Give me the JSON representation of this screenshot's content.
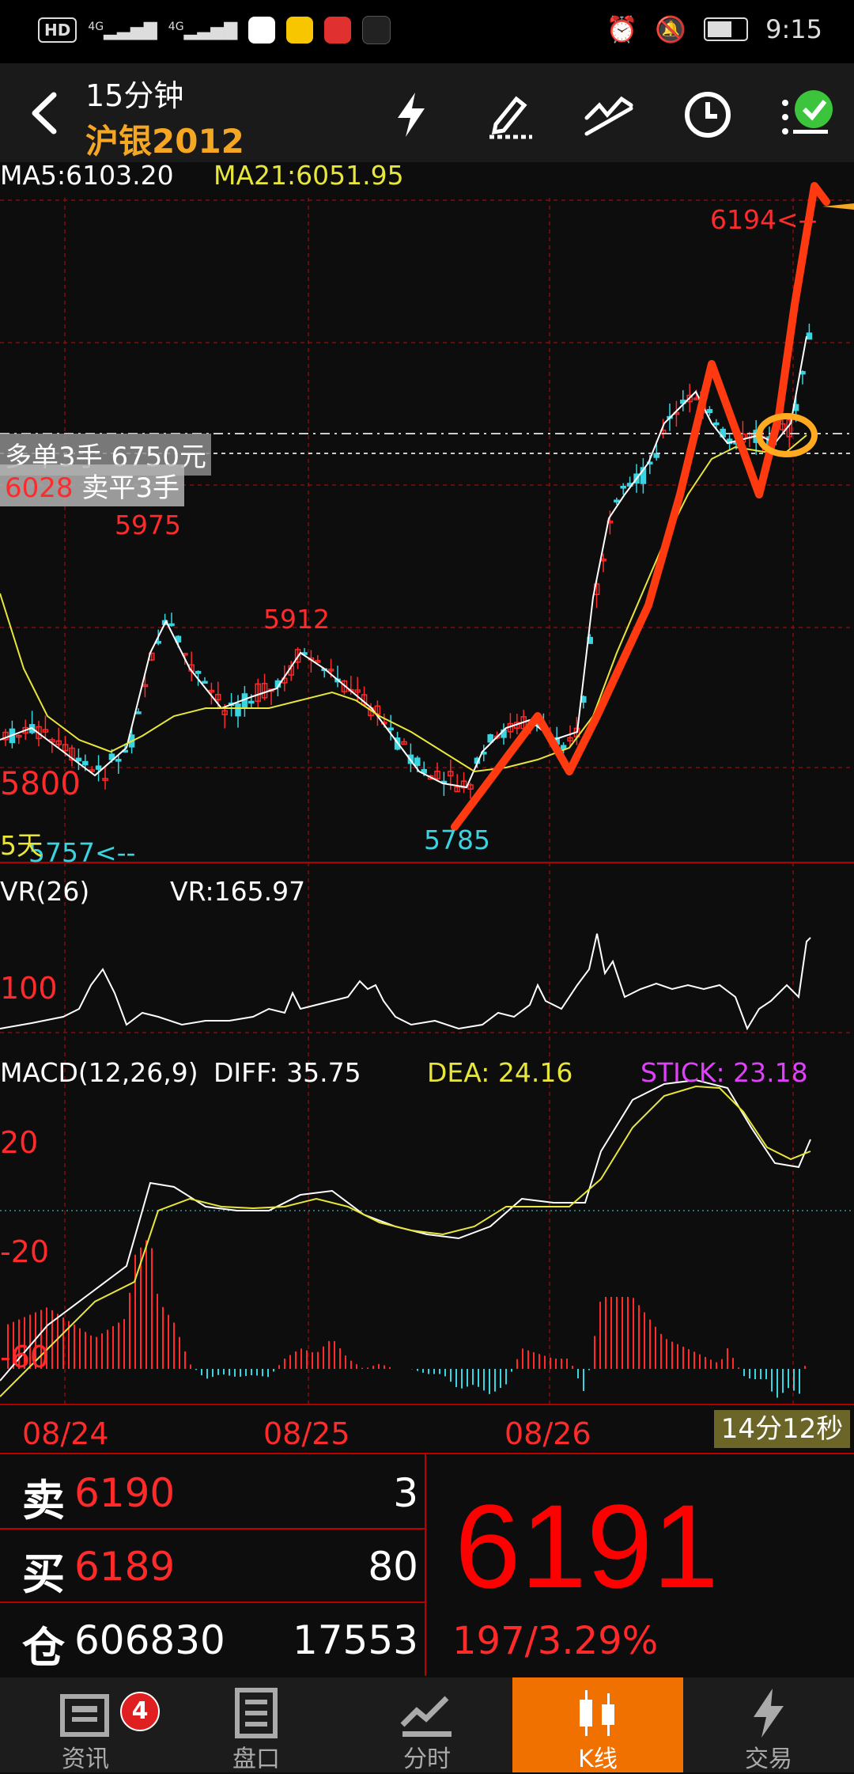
{
  "status_bar": {
    "badge": "HD",
    "net1": "4G",
    "net2": "4G",
    "time": "9:15"
  },
  "header": {
    "period": "15分钟",
    "contract": "沪银2012"
  },
  "indicators": {
    "ma5": "MA5:6103.20",
    "ma21": "MA21:6051.95",
    "vr_name": "VR(26)",
    "vr_value": "VR:165.97",
    "macd_name": "MACD(12,26,9)",
    "diff": "DIFF: 35.75",
    "dea": "DEA: 24.16",
    "stick": "STICK: 23.18"
  },
  "chart_labels": {
    "high_marker": "6194<--",
    "peak_5975": "5975",
    "peak_5912": "5912",
    "low_5785": "5785",
    "low_5757": "5757<--",
    "level_5800": "5800",
    "days": "5天",
    "vr_level": "100",
    "macd_20": "20",
    "macd_neg20": "-20",
    "macd_neg60": "-60",
    "order_long": "多单3手  6750元",
    "order_price": "6028",
    "order_close": "卖平3手",
    "countdown": "14分12秒"
  },
  "chart_data": {
    "type": "candlestick",
    "x_dates": [
      "08/24",
      "08/25",
      "08/26"
    ],
    "annotated_prices": {
      "high": 6194,
      "peak1": 5975,
      "peak2": 5912,
      "low1": 5785,
      "low2": 5757
    },
    "ma5": 6103.2,
    "ma21": 6051.95,
    "vr": 165.97,
    "macd": {
      "diff": 35.75,
      "dea": 24.16,
      "stick": 23.18
    }
  },
  "quote": {
    "sell_label": "卖",
    "sell_price": "6190",
    "sell_vol": "3",
    "buy_label": "买",
    "buy_price": "6189",
    "buy_vol": "80",
    "oi_label": "仓",
    "oi_value": "606830",
    "oi_change": "17553",
    "last_price": "6191",
    "change": "197/3.29%"
  },
  "tabs": [
    {
      "label": "资讯",
      "badge": "4"
    },
    {
      "label": "盘口"
    },
    {
      "label": "分时"
    },
    {
      "label": "K线"
    },
    {
      "label": "交易"
    }
  ],
  "colors": {
    "up": "#ff2a2a",
    "down": "#3ad3e0",
    "ma5": "#ffffff",
    "ma21": "#e8e63a",
    "accent": "#f07000",
    "stick": "#e040fb"
  }
}
